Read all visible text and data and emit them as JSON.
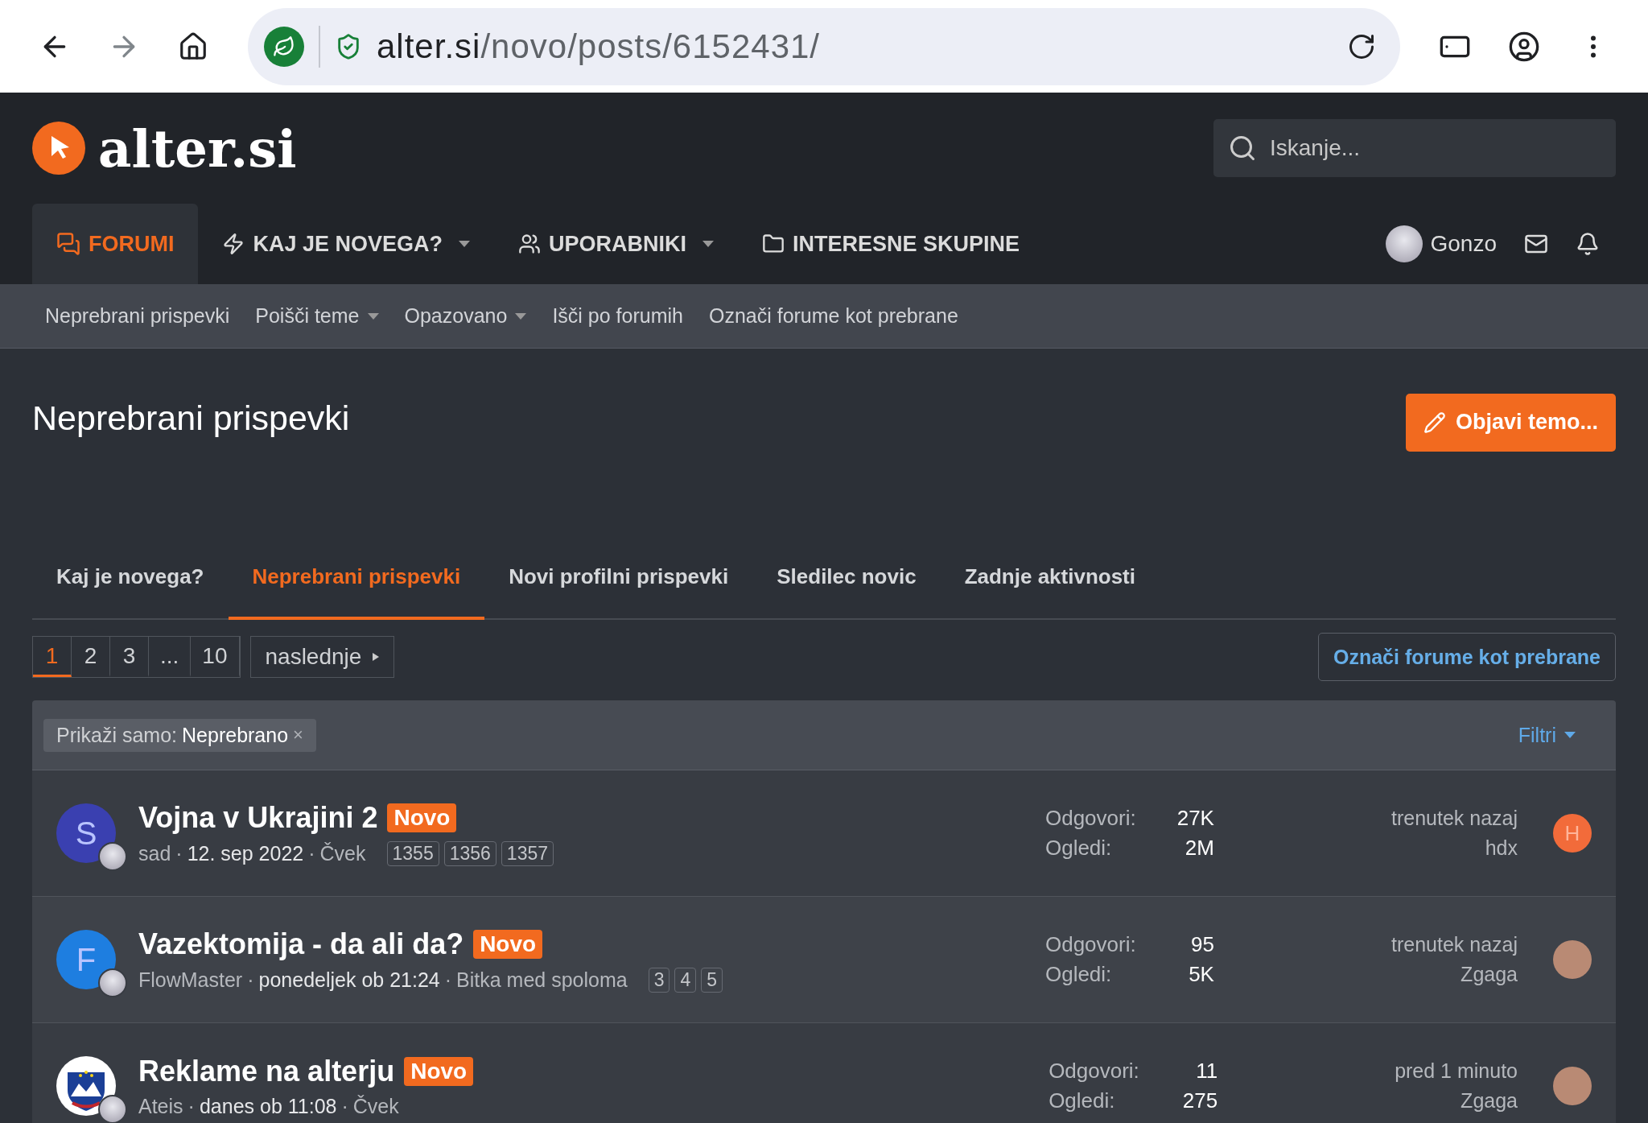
{
  "browser": {
    "url_host": "alter.si",
    "url_path": "/novo/posts/6152431/"
  },
  "site": {
    "logo_text": "alter.si",
    "search": {
      "placeholder": "Iskanje..."
    }
  },
  "nav": {
    "tabs": [
      {
        "label": "FORUMI",
        "dropdown": false,
        "selected": true
      },
      {
        "label": "KAJ JE NOVEGA?",
        "dropdown": true,
        "selected": false
      },
      {
        "label": "UPORABNIKI",
        "dropdown": true,
        "selected": false
      },
      {
        "label": "INTERESNE SKUPINE",
        "dropdown": false,
        "selected": false
      }
    ],
    "user": {
      "name": "Gonzo"
    }
  },
  "subnav": [
    {
      "label": "Neprebrani prispevki",
      "dropdown": false
    },
    {
      "label": "Poišči teme",
      "dropdown": true
    },
    {
      "label": "Opazovano",
      "dropdown": true
    },
    {
      "label": "Išči po forumih",
      "dropdown": false
    },
    {
      "label": "Označi forume kot prebrane",
      "dropdown": false
    }
  ],
  "page": {
    "title": "Neprebrani prispevki",
    "post_button": "Objavi temo..."
  },
  "tabs": [
    {
      "label": "Kaj je novega?",
      "selected": false
    },
    {
      "label": "Neprebrani prispevki",
      "selected": true
    },
    {
      "label": "Novi profilni prispevki",
      "selected": false
    },
    {
      "label": "Sledilec novic",
      "selected": false
    },
    {
      "label": "Zadnje aktivnosti",
      "selected": false
    }
  ],
  "pagination": {
    "pages": [
      {
        "label": "1",
        "selected": true
      },
      {
        "label": "2",
        "selected": false
      },
      {
        "label": "3",
        "selected": false
      },
      {
        "label": "...",
        "selected": false
      },
      {
        "label": "10",
        "selected": false
      }
    ],
    "next": "naslednje"
  },
  "mark_read_button": "Označi forume kot prebrane",
  "filter": {
    "label": "Prikaži samo:",
    "value": "Neprebrano",
    "remove": "×",
    "filters_button": "Filtri"
  },
  "threads": [
    {
      "avatar": {
        "kind": "letter",
        "letter": "S",
        "color": "#3a40b0"
      },
      "title": "Vojna v Ukrajini 2",
      "badge": "Novo",
      "author": "sad",
      "sep_1": "·",
      "date": "12. sep 2022",
      "sep_2": "·",
      "forum": "Čvek",
      "pages": [
        "1355",
        "1356",
        "1357"
      ],
      "replies_label": "Odgovori:",
      "replies": "27K",
      "views_label": "Ogledi:",
      "views": "2M",
      "last_time": "trenutek nazaj",
      "last_user": "hdx",
      "last_avatar": {
        "kind": "letter",
        "letter": "H",
        "color": "#f26b3a"
      }
    },
    {
      "avatar": {
        "kind": "letter",
        "letter": "F",
        "color": "#1e7ee0"
      },
      "title": "Vazektomija - da ali da?",
      "badge": "Novo",
      "author": "FlowMaster",
      "sep_1": "·",
      "date": "ponedeljek ob 21:24",
      "sep_2": "·",
      "forum": "Bitka med spoloma",
      "pages": [
        "3",
        "4",
        "5"
      ],
      "replies_label": "Odgovori:",
      "replies": "95",
      "views_label": "Ogledi:",
      "views": "5K",
      "last_time": "trenutek nazaj",
      "last_user": "Zgaga",
      "last_avatar": {
        "kind": "photo"
      }
    },
    {
      "avatar": {
        "kind": "flag"
      },
      "title": "Reklame na alterju",
      "badge": "Novo",
      "author": "Ateis",
      "sep_1": "·",
      "date": "danes ob 11:08",
      "sep_2": "·",
      "forum": "Čvek",
      "replies_label": "Odgovori:",
      "replies": "11",
      "views_label": "Ogledi:",
      "views": "275",
      "last_time": "pred 1 minuto",
      "last_user": "Zgaga",
      "last_avatar": {
        "kind": "photo"
      }
    }
  ]
}
